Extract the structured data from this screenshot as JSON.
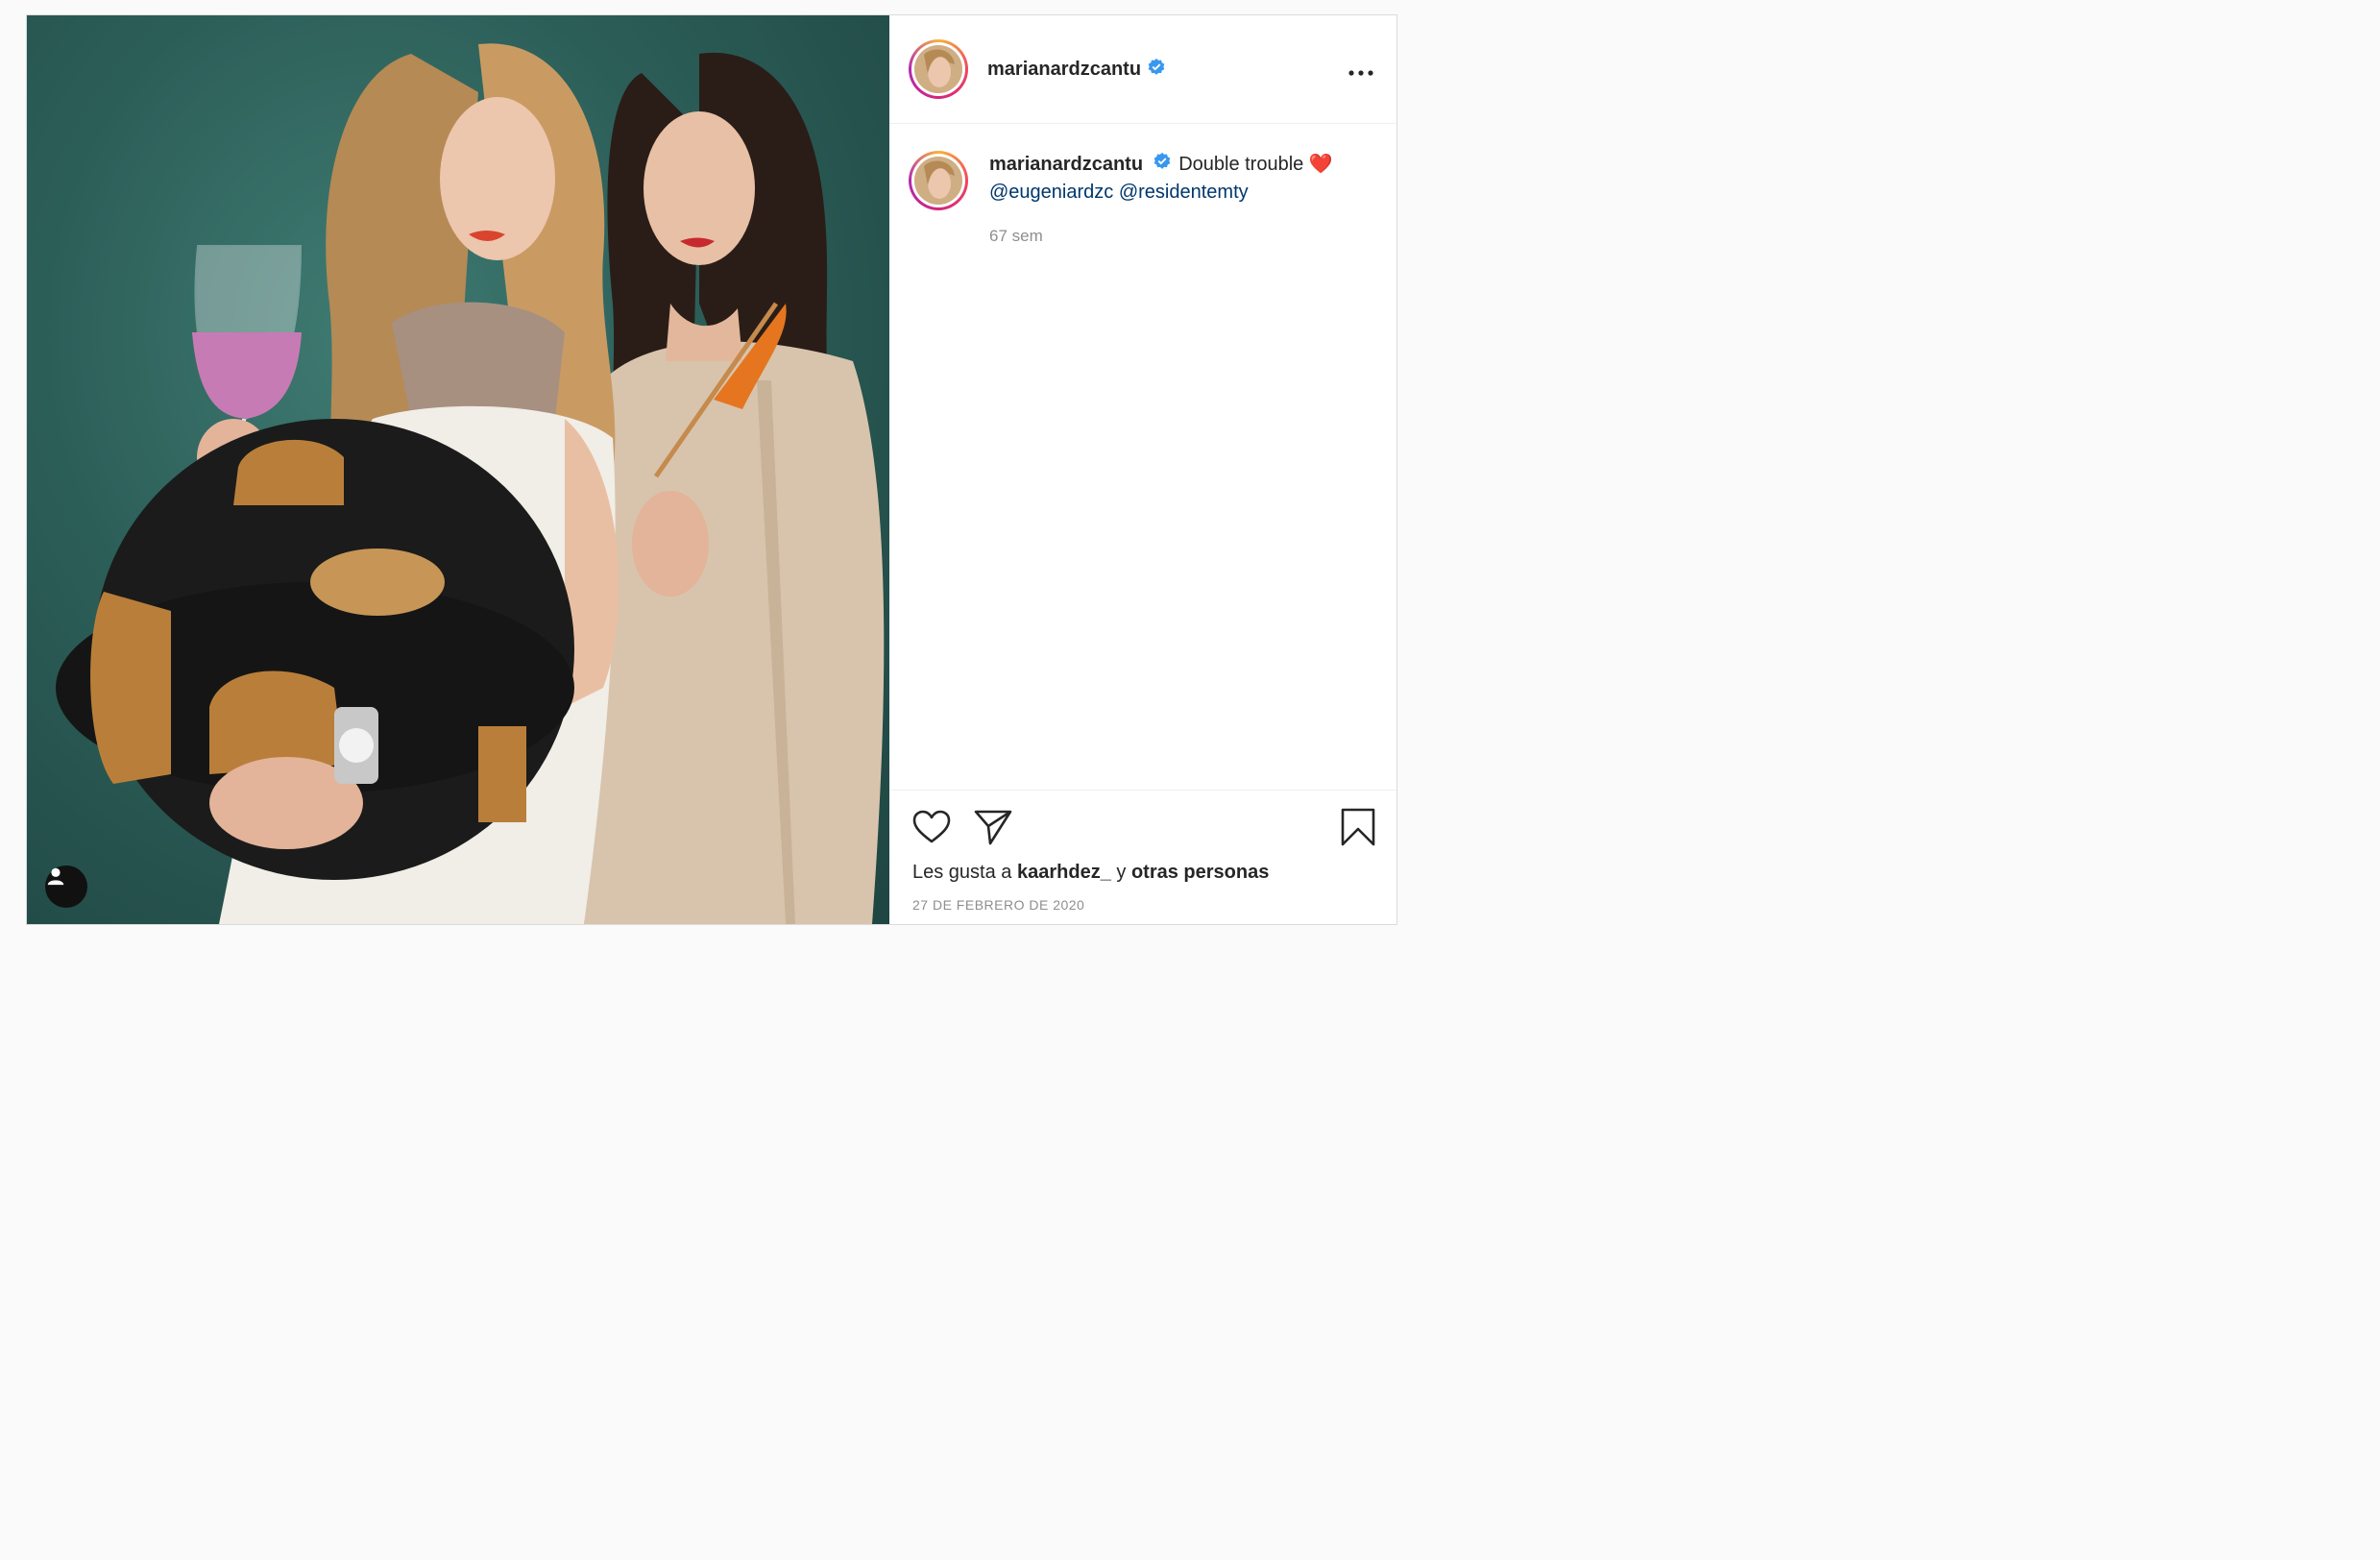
{
  "post": {
    "username": "marianardzcantu",
    "verified": true,
    "more_icon": "more-horizontal-icon",
    "caption": {
      "username": "marianardzcantu",
      "text": "Double trouble",
      "emoji": "❤️",
      "mentions": [
        "@eugeniardzc",
        "@residentemty"
      ]
    },
    "time_ago": "67 sem",
    "likes": {
      "prefix": "Les gusta a",
      "user": "kaarhdez_",
      "joiner": "y",
      "others": "otras personas"
    },
    "date": "27 DE FEBRERO DE 2020",
    "icons": {
      "like": "heart-icon",
      "share": "paper-plane-icon",
      "save": "bookmark-icon",
      "tagged": "user-icon"
    },
    "colors": {
      "link": "#00376b",
      "verified": "#3897f0",
      "muted": "#8e8e8e",
      "text": "#262626"
    }
  }
}
